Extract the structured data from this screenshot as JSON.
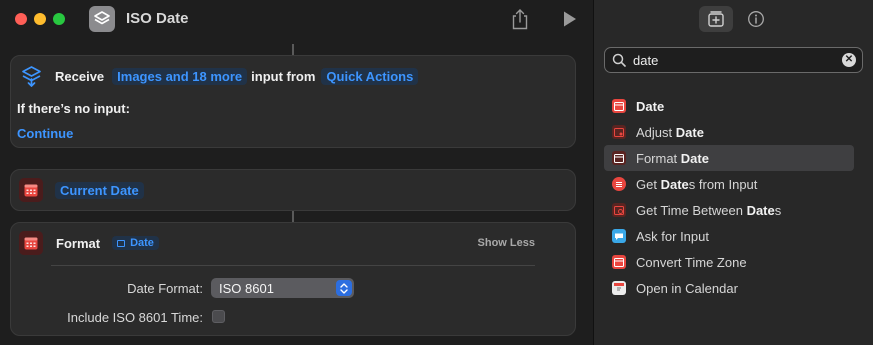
{
  "window": {
    "title": "ISO Date"
  },
  "receive_card": {
    "receive_label": "Receive",
    "input_types": "Images and 18 more",
    "input_from_label": "input from",
    "source": "Quick Actions",
    "no_input_label": "If there’s no input:",
    "no_input_action": "Continue"
  },
  "current_date_card": {
    "label": "Current Date"
  },
  "format_card": {
    "title": "Format",
    "input_token": "Date",
    "show_less": "Show Less",
    "date_format_label": "Date Format:",
    "date_format_value": "ISO 8601",
    "include_time_label": "Include ISO 8601 Time:",
    "include_time_checked": false
  },
  "library": {
    "search_value": "date",
    "results": [
      {
        "pre": "",
        "match": "Date",
        "post": "",
        "icon": "calendar-icon",
        "style": "red"
      },
      {
        "pre": "Adjust ",
        "match": "Date",
        "post": "",
        "icon": "adjust-calendar-icon",
        "style": "dark"
      },
      {
        "pre": "Format ",
        "match": "Date",
        "post": "",
        "icon": "calendar-icon",
        "style": "dark"
      },
      {
        "pre": "Get ",
        "match": "Date",
        "post": "s from Input",
        "icon": "list-icon",
        "style": "red"
      },
      {
        "pre": "Get Time Between ",
        "match": "Date",
        "post": "s",
        "icon": "calendar-clock-icon",
        "style": "dark"
      },
      {
        "pre": "Ask for Input",
        "match": "",
        "post": "",
        "icon": "chat-bubble-icon",
        "style": "blue"
      },
      {
        "pre": "Convert Time Zone",
        "match": "",
        "post": "",
        "icon": "calendar-icon",
        "style": "red"
      },
      {
        "pre": "Open in Calendar",
        "match": "",
        "post": "",
        "icon": "calendar-app-icon",
        "style": "white"
      }
    ],
    "selected_index": 2
  },
  "colors": {
    "accent_blue": "#3d95ff",
    "calendar_red": "#e9463f",
    "card_bg": "#2b2b2b",
    "sidebar_bg": "#282828"
  }
}
